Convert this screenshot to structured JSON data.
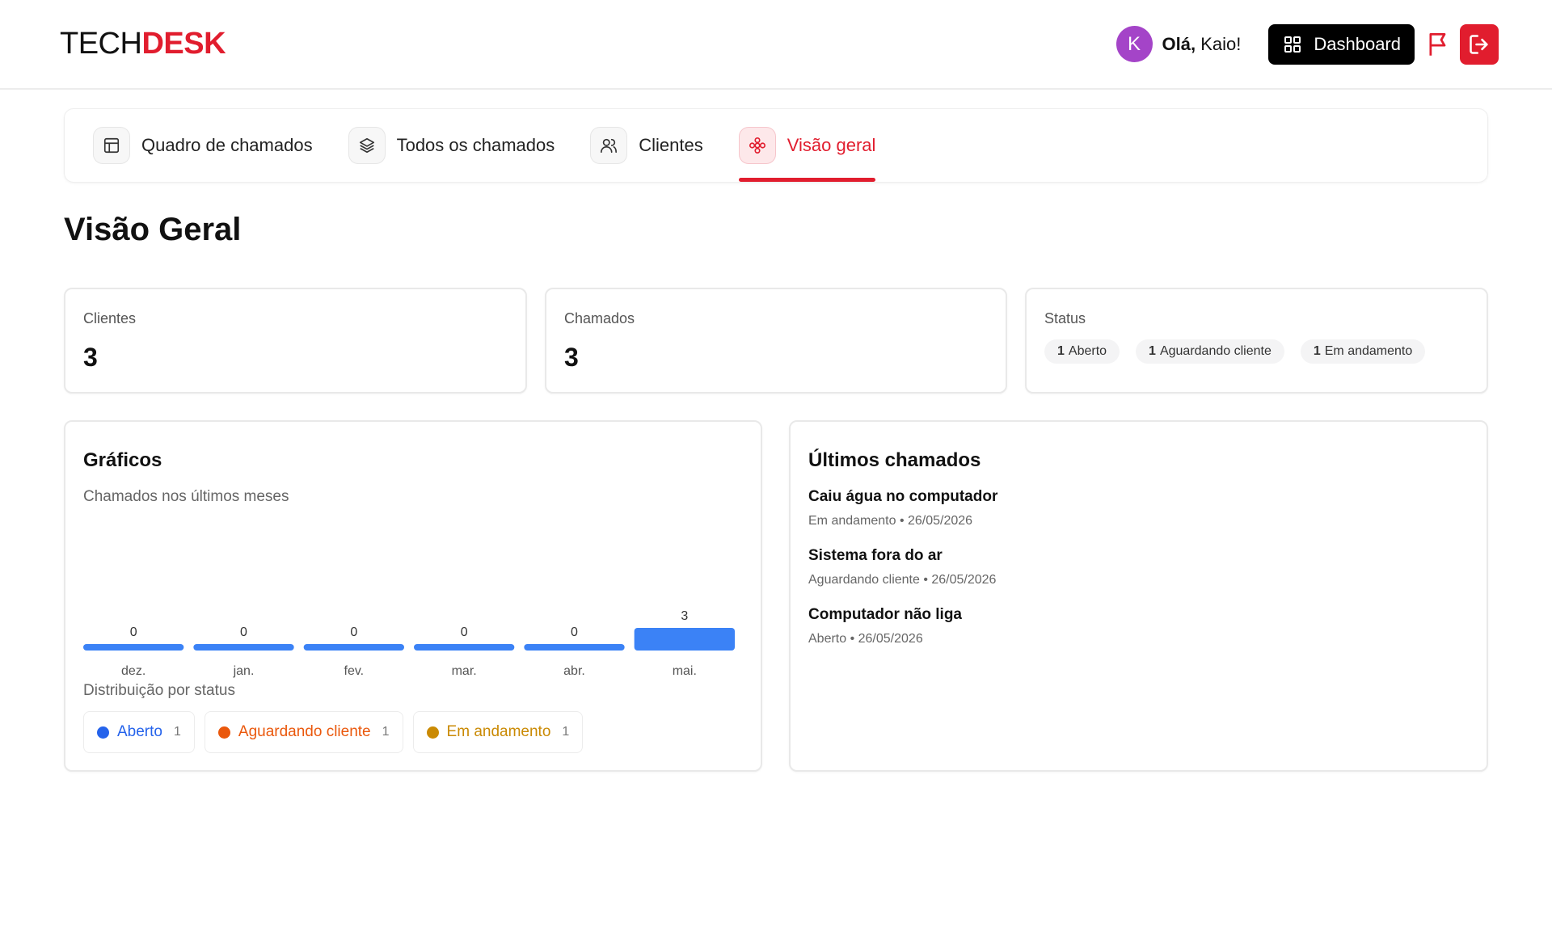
{
  "header": {
    "logo_part1": "TECH",
    "logo_part2": "DESK",
    "avatar_initial": "K",
    "greeting_bold": "Olá,",
    "greeting_name": " Kaio!",
    "dashboard_label": "Dashboard"
  },
  "nav": {
    "tabs": [
      {
        "label": "Quadro de chamados",
        "icon": "layout-icon",
        "active": false
      },
      {
        "label": "Todos os chamados",
        "icon": "layers-icon",
        "active": false
      },
      {
        "label": "Clientes",
        "icon": "users-icon",
        "active": false
      },
      {
        "label": "Visão geral",
        "icon": "flower-icon",
        "active": true
      }
    ]
  },
  "page": {
    "title": "Visão Geral"
  },
  "stats": {
    "clientes_label": "Clientes",
    "clientes_value": "3",
    "chamados_label": "Chamados",
    "chamados_value": "3",
    "status_label": "Status",
    "status_pills": [
      {
        "count": "1",
        "label": "Aberto"
      },
      {
        "count": "1",
        "label": "Aguardando cliente"
      },
      {
        "count": "1",
        "label": "Em andamento"
      }
    ]
  },
  "graficos": {
    "title": "Gráficos",
    "subtitle": "Chamados nos últimos meses",
    "dist_label": "Distribuição por status",
    "legend": [
      {
        "label": "Aberto",
        "count": "1",
        "color": "#2563eb"
      },
      {
        "label": "Aguardando cliente",
        "count": "1",
        "color": "#ea580c"
      },
      {
        "label": "Em andamento",
        "count": "1",
        "color": "#ca8a04"
      }
    ]
  },
  "chart_data": {
    "type": "bar",
    "categories": [
      "dez.",
      "jan.",
      "fev.",
      "mar.",
      "abr.",
      "mai."
    ],
    "values": [
      0,
      0,
      0,
      0,
      0,
      3
    ],
    "title": "Chamados nos últimos meses",
    "color": "#3b82f6"
  },
  "ultimos": {
    "title": "Últimos chamados",
    "tickets": [
      {
        "title": "Caiu água no computador",
        "meta": "Em andamento • 26/05/2026"
      },
      {
        "title": "Sistema fora do ar",
        "meta": "Aguardando cliente • 26/05/2026"
      },
      {
        "title": "Computador não liga",
        "meta": "Aberto • 26/05/2026"
      }
    ]
  },
  "colors": {
    "brand": "#e11d2e",
    "bar": "#3b82f6"
  }
}
